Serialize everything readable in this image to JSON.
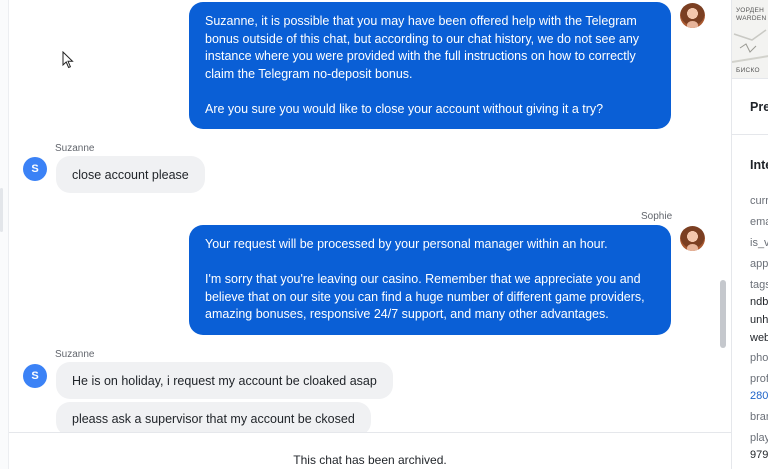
{
  "chat": {
    "messages": [
      {
        "sender": "Sophie",
        "paragraphs": [
          "Suzanne, it is possible that you may have been offered help with the Telegram bonus outside of this chat, but according to our chat history, we do not see any instance where you were provided with the full instructions on how to correctly claim the Telegram no-deposit bonus.",
          "Are you sure you would like to close your account without giving it a try?"
        ]
      },
      {
        "sender": "Suzanne",
        "avatar_initial": "S",
        "text": "close account please"
      },
      {
        "sender": "Sophie",
        "paragraphs": [
          "Your request will be processed by your personal manager within an hour.",
          "I'm sorry that you're leaving our casino. Remember that we appreciate you and believe that on our site you can find a huge number of different game providers, amazing bonuses, responsive 24/7 support, and many other advantages."
        ]
      },
      {
        "sender": "Suzanne",
        "avatar_initial": "S",
        "texts": [
          "He is on holiday, i request my account be cloaked asap",
          "pleass ask a supervisor that my account be ckosed"
        ]
      }
    ],
    "archived_notice": "This chat has been archived.",
    "colors": {
      "agent_bubble": "#0a5fd6",
      "user_bubble": "#f0f1f3",
      "user_avatar": "#3b82f6"
    }
  },
  "sidebar": {
    "map_labels": [
      "УОРДЕН",
      "WARDEN",
      "БИСКО"
    ],
    "section_pre": "Pre",
    "section_int": "Inte",
    "rows": [
      {
        "label": "curr"
      },
      {
        "label": "ema"
      },
      {
        "label": "is_v"
      },
      {
        "label": "app"
      },
      {
        "label": "tags",
        "values": [
          "ndb",
          "unh",
          "web"
        ]
      },
      {
        "label": "pho"
      },
      {
        "label": "prof",
        "link": "280"
      },
      {
        "label": "bran"
      },
      {
        "label": "play",
        "value": "979"
      }
    ]
  }
}
